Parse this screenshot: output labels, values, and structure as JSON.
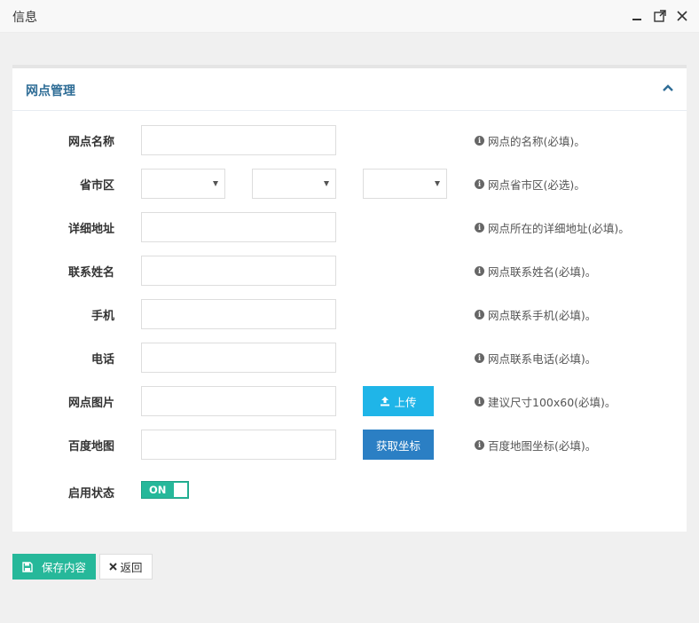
{
  "window": {
    "title": "信息"
  },
  "panel": {
    "title": "网点管理"
  },
  "form": {
    "name": {
      "label": "网点名称",
      "value": "",
      "help": "网点的名称(必填)。"
    },
    "region": {
      "label": "省市区",
      "province": "",
      "city": "",
      "district": "",
      "help": "网点省市区(必选)。"
    },
    "address": {
      "label": "详细地址",
      "value": "",
      "help": "网点所在的详细地址(必填)。"
    },
    "contact": {
      "label": "联系姓名",
      "value": "",
      "help": "网点联系姓名(必填)。"
    },
    "mobile": {
      "label": "手机",
      "value": "",
      "help": "网点联系手机(必填)。"
    },
    "phone": {
      "label": "电话",
      "value": "",
      "help": "网点联系电话(必填)。"
    },
    "image": {
      "label": "网点图片",
      "value": "",
      "button": "上传",
      "help": "建议尺寸100x60(必填)。"
    },
    "map": {
      "label": "百度地图",
      "value": "",
      "button": "获取坐标",
      "help": "百度地图坐标(必填)。"
    },
    "status": {
      "label": "启用状态",
      "toggle_text": "ON"
    }
  },
  "actions": {
    "save": "保存内容",
    "back": "返回"
  },
  "colors": {
    "accent": "#26b89a",
    "upload": "#1fb5e8",
    "coord": "#2b7fc4",
    "panel_title": "#2f6d96"
  }
}
